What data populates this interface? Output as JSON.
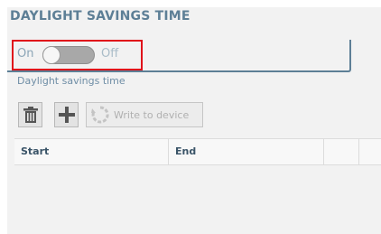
{
  "section": {
    "title": "DAYLIGHT SAVINGS TIME"
  },
  "toggle": {
    "on_label": "On",
    "off_label": "Off",
    "state": "off",
    "description": "Daylight savings time"
  },
  "toolbar": {
    "delete_icon": "trash-icon",
    "add_icon": "plus-icon",
    "write_icon": "refresh-icon",
    "write_label": "Write to device"
  },
  "table": {
    "columns": [
      "Start",
      "End",
      "",
      ""
    ],
    "rows": []
  },
  "colors": {
    "title": "#5d7f96",
    "highlight": "#e0101a",
    "switch_track": "#a8a8a8"
  }
}
